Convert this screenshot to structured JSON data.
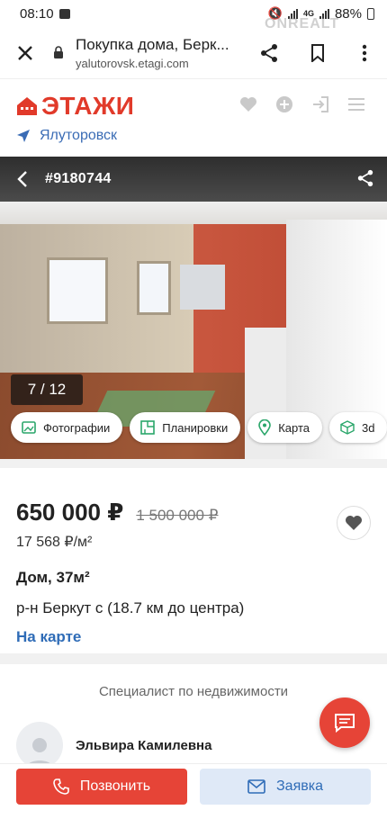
{
  "status_bar": {
    "time": "08:10",
    "network": "4G",
    "battery": "88%"
  },
  "browser": {
    "page_title": "Покупка дома, Берк...",
    "url": "yalutorovsk.etagi.com"
  },
  "watermark": "ONREALT",
  "site": {
    "logo_text": "ЭТАЖИ",
    "city": "Ялуторовск"
  },
  "gallery": {
    "listing_id": "#9180744",
    "counter": "7 / 12",
    "chips": [
      {
        "label": "Фотографии",
        "icon": "photo-icon"
      },
      {
        "label": "Планировки",
        "icon": "floorplan-icon"
      },
      {
        "label": "Карта",
        "icon": "map-pin-icon"
      },
      {
        "label": "3d",
        "icon": "cube-icon"
      }
    ]
  },
  "listing": {
    "price": "650 000 ₽",
    "old_price": "1 500 000 ₽",
    "price_per_m2": "17 568 ₽/м²",
    "type": "Дом, 37м²",
    "address": "р-н Беркут с (18.7 км до центра)",
    "map_link": "На карте"
  },
  "specialist": {
    "title": "Специалист по недвижимости",
    "name": "Эльвира Камилевна"
  },
  "actions": {
    "call": "Позвонить",
    "request": "Заявка"
  },
  "colors": {
    "brand_red": "#e13a2a",
    "link_blue": "#2f6cb7",
    "button_red": "#e64437",
    "request_bg": "#dfe9f7"
  }
}
